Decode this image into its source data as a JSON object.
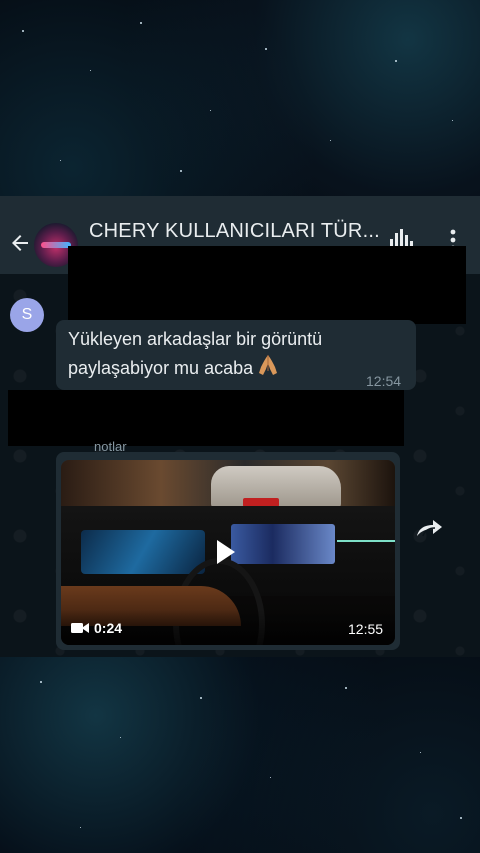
{
  "header": {
    "group_title": "CHERY KULLANICILARI TÜR..."
  },
  "messages": [
    {
      "sender_initial": "S",
      "text_line_1": "Yükleyen arkadaşlar bir görüntü",
      "text_line_2": "paylaşabiyor mu  acaba",
      "emoji": "folded-hands-emoji",
      "time": "12:54"
    },
    {
      "sender_partial": "notlar",
      "type": "video",
      "duration": "0:24",
      "time": "12:55"
    }
  ],
  "colors": {
    "header_bg": "#1f2c34",
    "chat_bg": "#0b141a",
    "bubble_bg": "#1f2c34",
    "avatar_bg": "#9aa5e8",
    "secondary_text": "#8696a0"
  }
}
